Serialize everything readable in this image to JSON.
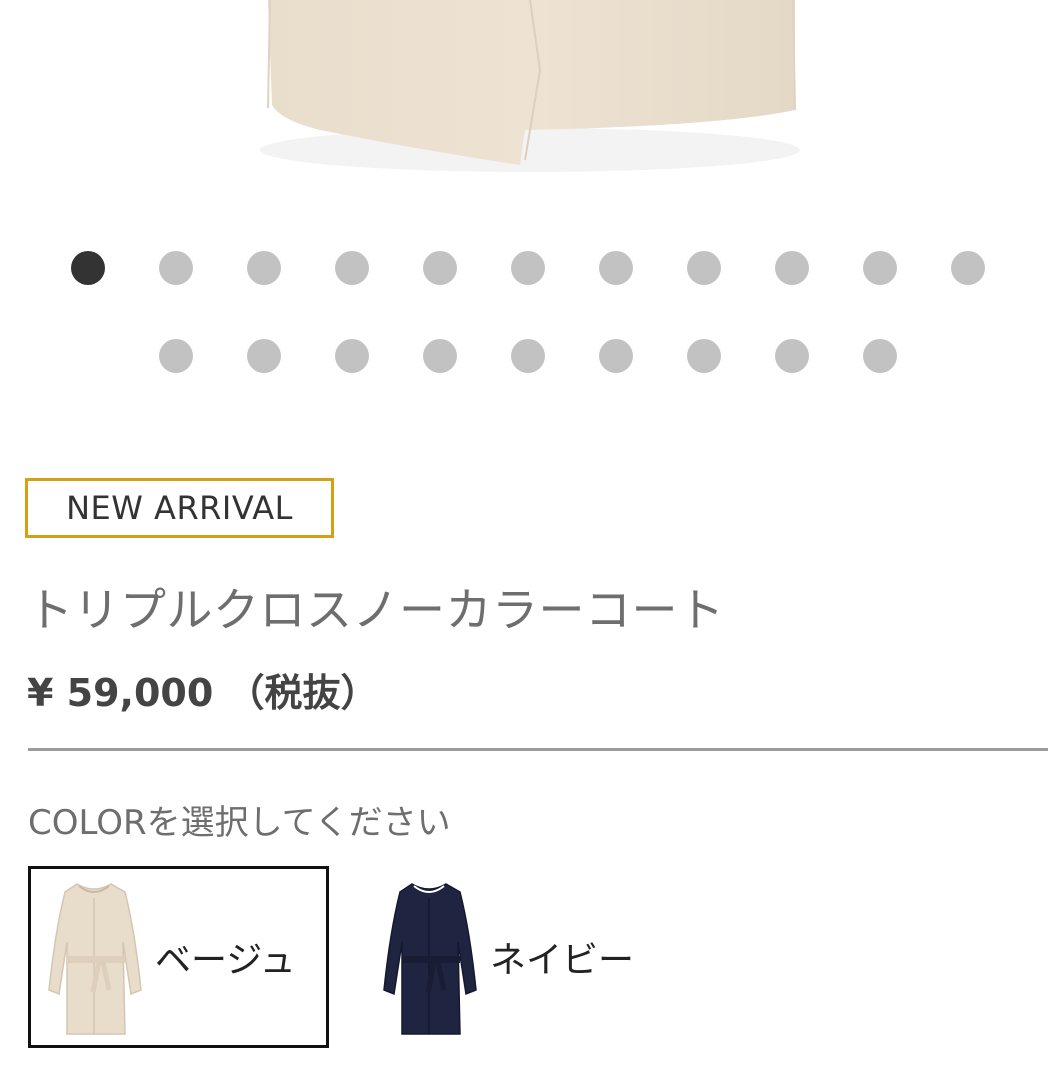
{
  "product_image": {
    "alt": ""
  },
  "gallery": {
    "total": 20,
    "active_index": 0
  },
  "badge": {
    "label": "NEW ARRIVAL",
    "color": "#d4a017"
  },
  "product": {
    "name": "トリプルクロスノーカラーコート",
    "price": "¥ 59,000 （税抜）"
  },
  "color_selector": {
    "label": "COLORを選択してください",
    "options": [
      {
        "name": "ベージュ",
        "color": "#e8dccb",
        "selected": true
      },
      {
        "name": "ネイビー",
        "color": "#1f2440",
        "selected": false
      }
    ]
  }
}
